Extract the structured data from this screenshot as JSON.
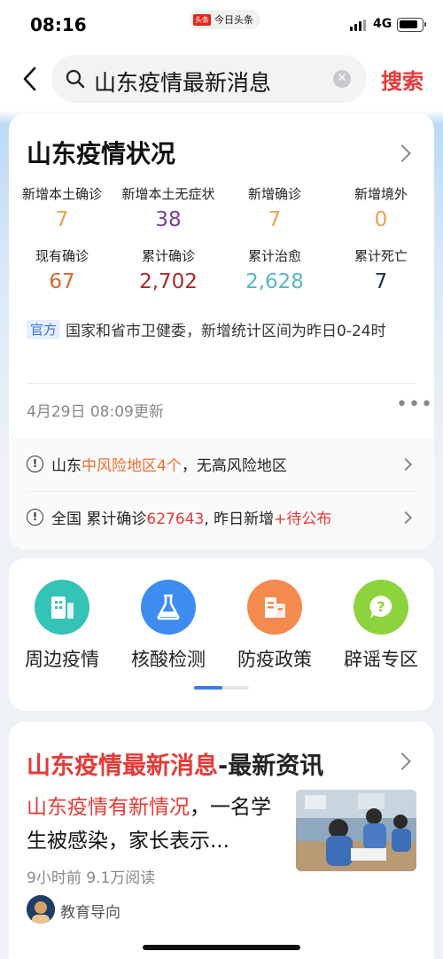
{
  "status_bar": {
    "time": "08:16",
    "app_badge": "头条",
    "app_name": "今日头条",
    "network": "4G"
  },
  "search": {
    "query": "山东疫情最新消息",
    "submit_label": "搜索",
    "clear_icon": "clear-icon",
    "colors": {
      "submit": "#e5393c"
    }
  },
  "stats_card": {
    "title": "山东疫情状况",
    "stats": [
      {
        "label": "新增本土确诊",
        "value": "7",
        "color": "#e8a44a"
      },
      {
        "label": "新增本土无症状",
        "value": "38",
        "color": "#7b3f8f"
      },
      {
        "label": "新增确诊",
        "value": "7",
        "color": "#e8a44a"
      },
      {
        "label": "新增境外",
        "value": "0",
        "color": "#e8a44a"
      },
      {
        "label": "现有确诊",
        "value": "67",
        "color": "#d8672c"
      },
      {
        "label": "累计确诊",
        "value": "2,702",
        "color": "#a42b2b"
      },
      {
        "label": "累计治愈",
        "value": "2,628",
        "color": "#5ab6c8"
      },
      {
        "label": "累计死亡",
        "value": "7",
        "color": "#1e3450"
      }
    ],
    "source_tag": "官方",
    "source_text": "国家和省市卫健委，新增统计区间为昨日0-24时",
    "updated": "4月29日 08:09更新"
  },
  "alerts": [
    {
      "parts": [
        "山东",
        "中风险地区4个",
        "，无高风险地区"
      ]
    },
    {
      "parts": [
        "全国 累计确诊",
        "627643",
        ", 昨日新增",
        "+待公布"
      ]
    }
  ],
  "shortcuts": [
    {
      "label": "周边疫情",
      "icon": "buildings-icon",
      "color": "#34c3b5"
    },
    {
      "label": "核酸检测",
      "icon": "flask-icon",
      "color": "#3e8cf0"
    },
    {
      "label": "防疫政策",
      "icon": "document-building-icon",
      "color": "#f38a4e"
    },
    {
      "label": "辟谣专区",
      "icon": "question-bubble-icon",
      "color": "#8dd33d"
    }
  ],
  "news": {
    "header_red": "山东疫情最新消息",
    "header_rest": "-最新资讯",
    "title_red": "山东疫情有新情况",
    "title_rest": "，一名学生被感染，家长表示...",
    "meta": "9小时前  9.1万阅读",
    "author": "教育导向"
  }
}
